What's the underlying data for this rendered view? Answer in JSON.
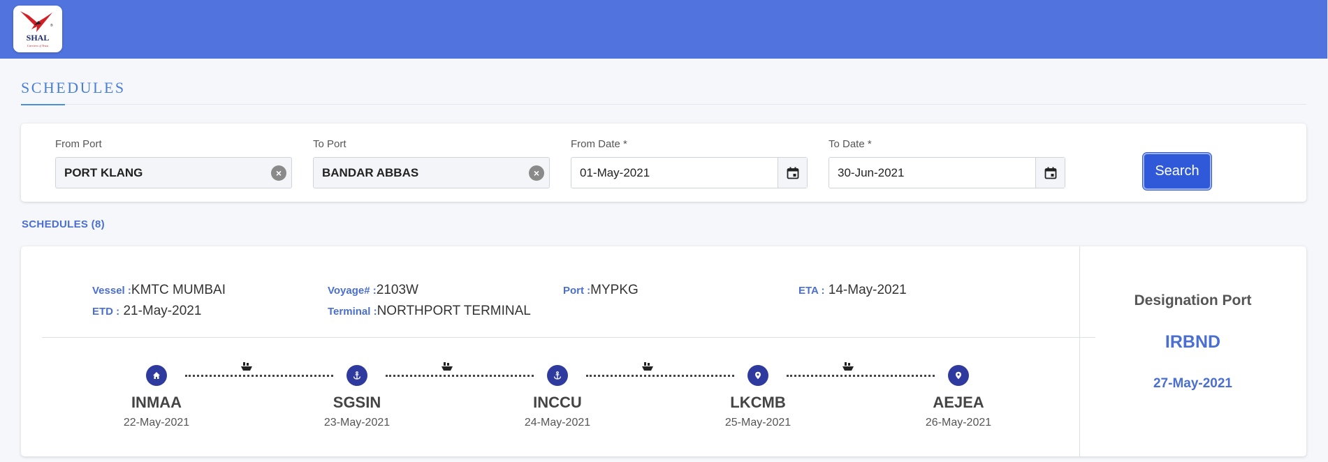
{
  "header": {
    "logo_text": "SHAL",
    "logo_tagline": "Carriers of Trust",
    "logo_trademark": "®"
  },
  "page": {
    "title": "SCHEDULES"
  },
  "filters": {
    "from_port": {
      "label": "From Port",
      "value": "PORT KLANG"
    },
    "to_port": {
      "label": "To Port",
      "value": "BANDAR ABBAS"
    },
    "from_date": {
      "label": "From Date *",
      "value": "01-May-2021"
    },
    "to_date": {
      "label": "To Date *",
      "value": "30-Jun-2021"
    },
    "search_label": "Search"
  },
  "results": {
    "count_label": "SCHEDULES (8)",
    "schedule": {
      "vessel": {
        "label": "Vessel :",
        "value": "KMTC MUMBAI"
      },
      "etd": {
        "label": "ETD :",
        "value": " 21-May-2021"
      },
      "voyage": {
        "label": "Voyage# :",
        "value": "2103W"
      },
      "terminal": {
        "label": "Terminal :",
        "value": "NORTHPORT TERMINAL"
      },
      "port": {
        "label": "Port :",
        "value": "MYPKG"
      },
      "eta": {
        "label": "ETA :",
        "value": " 14-May-2021"
      },
      "route": [
        {
          "code": "INMAA",
          "date": "22-May-2021",
          "icon": "home-icon"
        },
        {
          "code": "SGSIN",
          "date": "23-May-2021",
          "icon": "anchor-icon"
        },
        {
          "code": "INCCU",
          "date": "24-May-2021",
          "icon": "anchor-icon"
        },
        {
          "code": "LKCMB",
          "date": "25-May-2021",
          "icon": "map-pin-icon"
        },
        {
          "code": "AEJEA",
          "date": "26-May-2021",
          "icon": "map-pin-icon"
        }
      ],
      "destination": {
        "title": "Designation Port",
        "code": "IRBND",
        "date": "27-May-2021"
      }
    }
  },
  "colors": {
    "header_bg": "#5073de",
    "accent": "#4a6fd0",
    "button": "#2f59d9",
    "stop_icon": "#2e3a9e"
  }
}
